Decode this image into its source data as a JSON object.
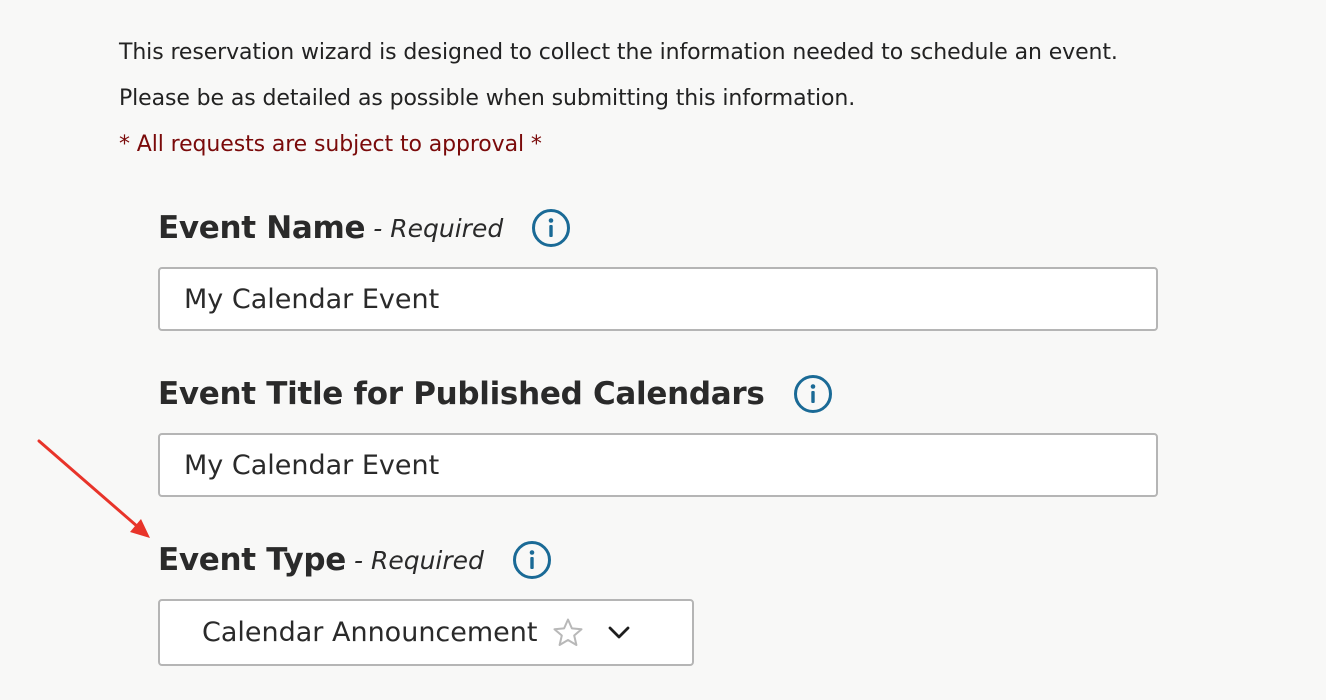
{
  "intro": {
    "line1": "This reservation wizard is designed to collect the information needed to schedule an event.",
    "line2": "Please be as detailed as possible when submitting this information.",
    "notice": "* All requests are subject to approval *"
  },
  "fields": {
    "event_name": {
      "label": "Event Name",
      "required": "- Required",
      "value": "My Calendar Event"
    },
    "event_title": {
      "label": "Event Title for Published Calendars",
      "value": "My Calendar Event"
    },
    "event_type": {
      "label": "Event Type",
      "required": "- Required",
      "selected": "Calendar Announcement"
    }
  },
  "icons": {
    "info": "info-circle-icon",
    "favorite": "star-outline-icon",
    "dropdown": "chevron-down-icon",
    "annotation": "red-arrow"
  },
  "colors": {
    "background": "#f8f8f7",
    "notice_text": "#7a0a0a",
    "info_icon": "#1a6a96",
    "input_border": "#b5b5b5",
    "annotation_arrow": "#e8342a"
  }
}
